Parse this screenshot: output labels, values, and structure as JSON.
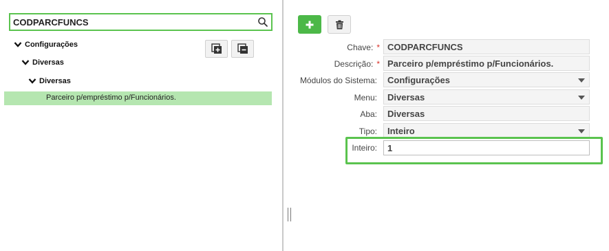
{
  "search": {
    "value": "CODPARCFUNCS"
  },
  "tree": {
    "level1": "Configurações",
    "level2": "Diversas",
    "level3": "Diversas",
    "selected_leaf": "Parceiro p/empréstimo p/Funcionários."
  },
  "form": {
    "chave_label": "Chave:",
    "chave_value": "CODPARCFUNCS",
    "descricao_label": "Descrição:",
    "descricao_value": "Parceiro p/empréstimo p/Funcionários.",
    "modulos_label": "Módulos do Sistema:",
    "modulos_value": "Configurações",
    "menu_label": "Menu:",
    "menu_value": "Diversas",
    "aba_label": "Aba:",
    "aba_value": "Diversas",
    "tipo_label": "Tipo:",
    "tipo_value": "Inteiro",
    "inteiro_label": "Inteiro:",
    "inteiro_value": "1",
    "required_mark": "*"
  },
  "colors": {
    "accent_green": "#4cb848",
    "selection_green": "#b5e6b0",
    "required_red": "#d9322a"
  }
}
